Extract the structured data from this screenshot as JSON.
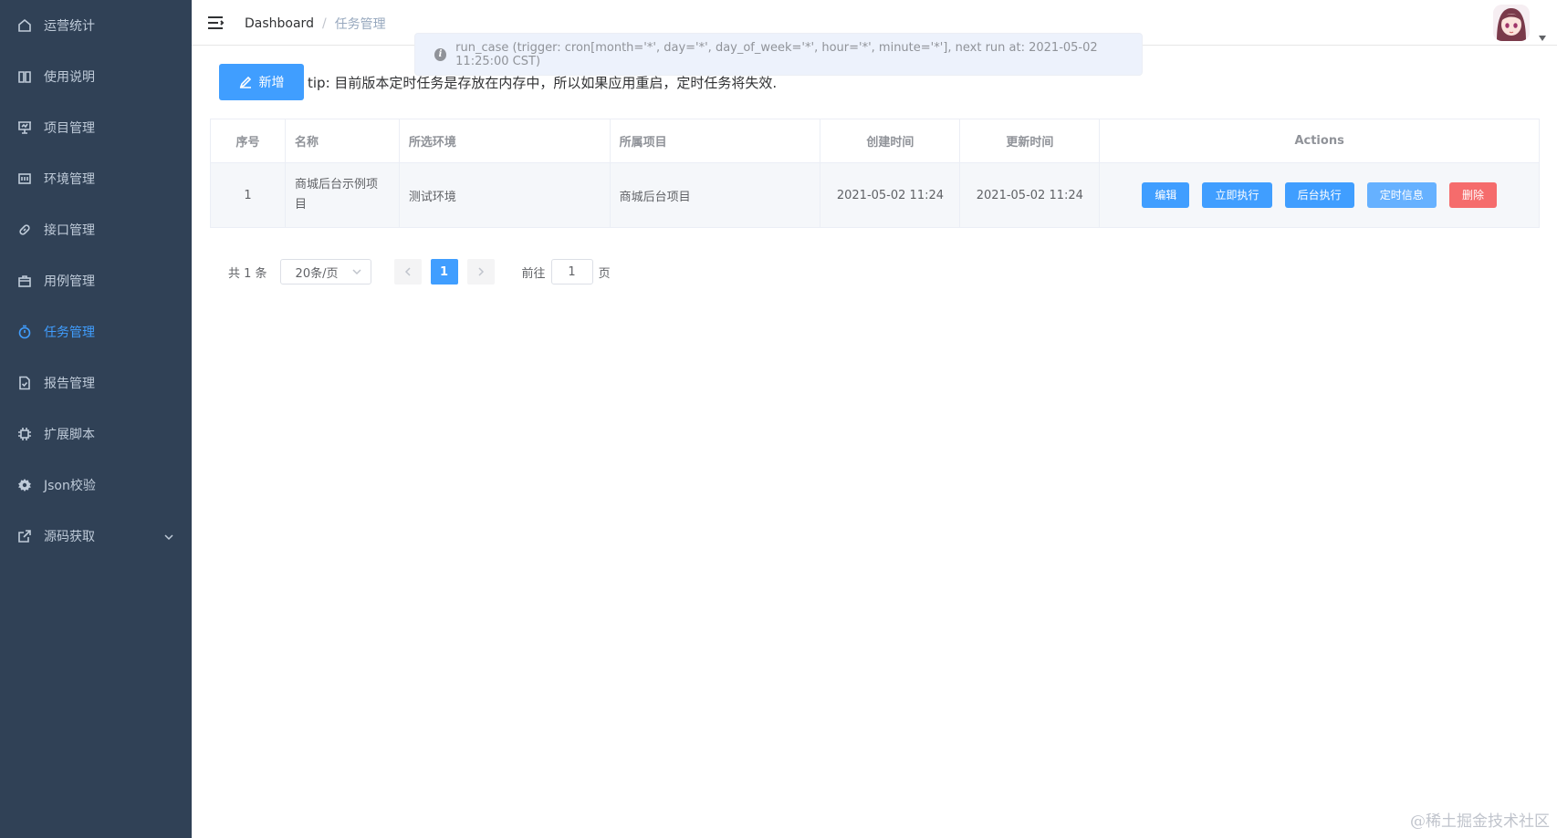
{
  "sidebar": {
    "items": [
      {
        "label": "运营统计",
        "icon": "home-icon"
      },
      {
        "label": "使用说明",
        "icon": "book-icon"
      },
      {
        "label": "项目管理",
        "icon": "presentation-icon"
      },
      {
        "label": "环境管理",
        "icon": "grid-icon"
      },
      {
        "label": "接口管理",
        "icon": "link-icon"
      },
      {
        "label": "用例管理",
        "icon": "briefcase-icon"
      },
      {
        "label": "任务管理",
        "icon": "timer-icon",
        "active": true
      },
      {
        "label": "报告管理",
        "icon": "document-check-icon"
      },
      {
        "label": "扩展脚本",
        "icon": "cpu-icon"
      },
      {
        "label": "Json校验",
        "icon": "gear-icon"
      },
      {
        "label": "源码获取",
        "icon": "external-link-icon"
      }
    ]
  },
  "header": {
    "breadcrumb_home": "Dashboard",
    "breadcrumb_sep": "/",
    "breadcrumb_current": "任务管理"
  },
  "message": {
    "text": "run_case (trigger: cron[month='*', day='*', day_of_week='*', hour='*', minute='*'], next run at: 2021-05-02 11:25:00 CST)"
  },
  "toolbar": {
    "add_label": "新增",
    "tip": "tip: 目前版本定时任务是存放在内存中，所以如果应用重启，定时任务将失效."
  },
  "table": {
    "headers": [
      "序号",
      "名称",
      "所选环境",
      "所属项目",
      "创建时间",
      "更新时间",
      "Actions"
    ],
    "rows": [
      {
        "index": "1",
        "name": "商城后台示例项目",
        "env": "测试环境",
        "project": "商城后台项目",
        "created": "2021-05-02 11:24",
        "updated": "2021-05-02 11:24"
      }
    ],
    "actions": {
      "edit": "编辑",
      "run_now": "立即执行",
      "run_background": "后台执行",
      "schedule_info": "定时信息",
      "delete": "删除"
    }
  },
  "pagination": {
    "total": "共 1 条",
    "page_size": "20条/页",
    "current_page": "1",
    "goto_label": "前往",
    "goto_value": "1",
    "page_suffix": "页"
  },
  "watermark": "@稀土掘金技术社区",
  "colors": {
    "sidebar_bg": "#304156",
    "primary": "#409eff",
    "danger": "#f56c6c"
  }
}
